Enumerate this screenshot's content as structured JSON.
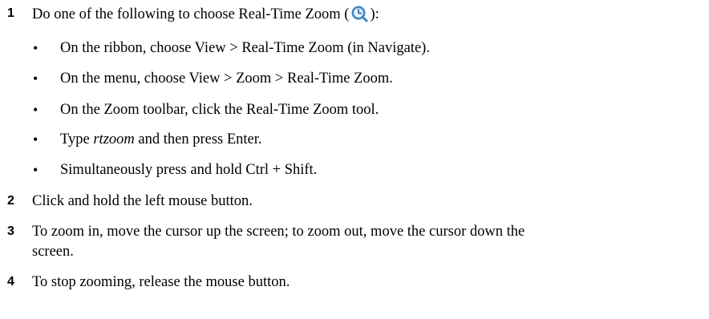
{
  "steps": [
    {
      "number": "1",
      "text_before_icon": "Do one of the following to choose Real-Time Zoom (",
      "icon": "realtime-zoom-icon",
      "text_after_icon": "):",
      "bullets": [
        "On the ribbon, choose View > Real-Time Zoom (in Navigate).",
        "On the menu, choose View > Zoom > Real-Time Zoom.",
        "On the Zoom toolbar, click the Real-Time Zoom tool."
      ],
      "typed_bullet": {
        "before": "Type ",
        "command": "rtzoom",
        "after": " and then press Enter."
      },
      "last_bullet": "Simultaneously press and hold Ctrl + Shift."
    },
    {
      "number": "2",
      "text": "Click and hold the left mouse button."
    },
    {
      "number": "3",
      "line1": "To zoom in, move the cursor up the screen; to zoom out, move the cursor down the",
      "line2": "screen."
    },
    {
      "number": "4",
      "text": "To stop zooming, release the mouse button."
    }
  ],
  "bullet_glyph": "•",
  "colors": {
    "icon_ring": "#3f86c6",
    "icon_fill": "#e8f1fa",
    "text": "#000000"
  }
}
